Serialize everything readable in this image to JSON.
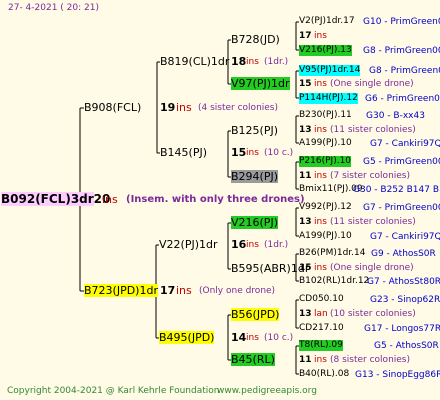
{
  "header": {
    "date": "27- 4-2021 ( 20: 21)"
  },
  "footer": {
    "copyright": "Copyright 2004-2021 @ Karl Kehrle Foundation",
    "site": "www.pedigreeapis.org"
  },
  "root": {
    "id": "B092(FCL)3dr",
    "count": "20",
    "ins": "ins",
    "note": "(Insem. with only three drones)"
  },
  "gen1": {
    "sire": {
      "id": "B908(FCL)",
      "count": "19",
      "ins": "ins",
      "note": "(4 sister colonies)"
    },
    "dam": {
      "id": "B723(JPD)1dr",
      "count": "17",
      "ins": "ins",
      "note": "(Only one drone)"
    }
  },
  "gen2": {
    "b819": {
      "id": "B819(CL)1dr",
      "count": "18",
      "ins": "ins",
      "note": "(1dr.)"
    },
    "b145": {
      "id": "B145(PJ)",
      "count": "15",
      "ins": "ins",
      "note": "(10 c.)"
    },
    "v22": {
      "id": "V22(PJ)1dr",
      "count": "16",
      "ins": "ins",
      "note": "(1dr.)"
    },
    "b495": {
      "id": "B495(JPD)",
      "count": "14",
      "ins": "ins",
      "note": "(10 c.)"
    }
  },
  "gen3": {
    "b728": "B728(JD)",
    "v97": "V97(PJ)1dr",
    "b125": "B125(PJ)",
    "b294": "B294(PJ)",
    "v216": "V216(PJ)",
    "b595": "B595(ABR)1dr",
    "b56": "B56(JPD)",
    "b45": "B45(RL)"
  },
  "gen4": {
    "g1": {
      "label": "V2(PJ)1dr.17",
      "source": "G10 - PrimGreen00"
    },
    "g1c": {
      "count": "17",
      "ins": "ins"
    },
    "g2": {
      "label": "V216(PJ).13",
      "source": "G8 - PrimGreen00"
    },
    "g3": {
      "label": "V95(PJ)1dr.14",
      "source": "G8 - PrimGreen00"
    },
    "g3c": {
      "count": "15",
      "ins": "ins",
      "note": "(One single drone)"
    },
    "g4": {
      "label": "P114H(PJ).12",
      "source": "G6 - PrimGreen00"
    },
    "g5": {
      "label": "B230(PJ).11",
      "source": "G30 - B-xx43"
    },
    "g5c": {
      "count": "13",
      "ins": "ins",
      "note": "(11 sister colonies)"
    },
    "g6": {
      "label": "A199(PJ).10",
      "source": "G7 - Cankiri97Q"
    },
    "g7": {
      "label": "P216(PJ).10",
      "source": "G5 - PrimGreen00"
    },
    "g7c": {
      "count": "11",
      "ins": "ins",
      "note": "(7 sister colonies)"
    },
    "g8": {
      "label": "Bmix11(PJ).09",
      "source": "G30 - B252 B147 B"
    },
    "g9": {
      "label": "V992(PJ).12",
      "source": "G7 - PrimGreen00"
    },
    "g9c": {
      "count": "13",
      "ins": "ins",
      "note": "(11 sister colonies)"
    },
    "g10": {
      "label": "A199(PJ).10",
      "source": "G7 - Cankiri97Q"
    },
    "g11": {
      "label": "B26(PM)1dr.14",
      "source": "G9 - AthosS0R"
    },
    "g11c": {
      "count": "15",
      "ins": "ins",
      "note": "(One single drone)"
    },
    "g12": {
      "label": "B102(RL)1dr.12",
      "source": "G7 - AthosSt80R"
    },
    "g13": {
      "label": "CD050.10",
      "source": "G23 - Sinop62R"
    },
    "g13c": {
      "count": "13",
      "ins": "lan",
      "note": "(10 sister colonies)"
    },
    "g14": {
      "label": "CD217.10",
      "source": "G17 - Longos77R"
    },
    "g15": {
      "label": "T8(RL).09",
      "source": "G5 - AthosS0R"
    },
    "g15c": {
      "count": "11",
      "ins": "ins",
      "note": "(8 sister colonies)"
    },
    "g16": {
      "label": "B40(RL).08",
      "source": "G13 - SinopEgg86R"
    }
  }
}
